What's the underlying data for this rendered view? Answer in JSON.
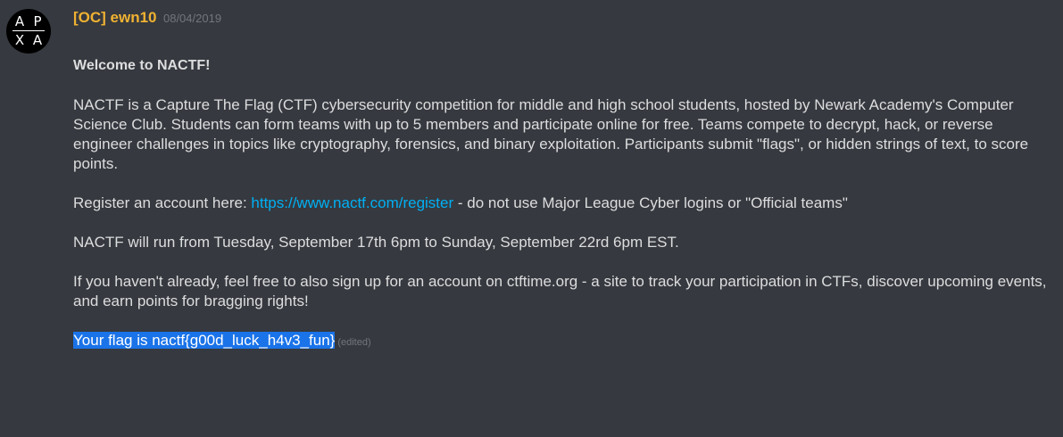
{
  "author": {
    "avatar_letters": [
      "A",
      "P",
      "X",
      "A"
    ],
    "name": "[OC] ewn10",
    "timestamp": "08/04/2019"
  },
  "message": {
    "title": "Welcome to NACTF!",
    "intro": "NACTF is a Capture The Flag (CTF) cybersecurity competition for middle and high school students, hosted by Newark Academy's Computer Science Club. Students can form teams with up to 5 members and participate online for free. Teams compete to decrypt, hack, or reverse engineer challenges in topics like cryptography, forensics, and binary exploitation. Participants submit \"flags\", or hidden strings of text, to score points.",
    "register_prefix": "Register an account here: ",
    "register_link": "https://www.nactf.com/register",
    "register_suffix": " - do not use Major League Cyber logins or \"Official teams\"",
    "schedule": "NACTF will run from Tuesday, September 17th 6pm to Sunday, September 22rd 6pm EST.",
    "ctftime": "If you haven't already, feel free to also sign up for an account on ctftime.org - a site to track your participation in CTFs, discover upcoming events, and earn points for bragging rights!",
    "flag": "Your flag is nactf{g00d_luck_h4v3_fun}",
    "edited_label": "(edited)"
  },
  "colors": {
    "background": "#36393f",
    "username": "#f0b232",
    "link": "#00b0f4",
    "text": "#dcddde",
    "muted": "#72767d",
    "selection": "#1a73e8"
  }
}
